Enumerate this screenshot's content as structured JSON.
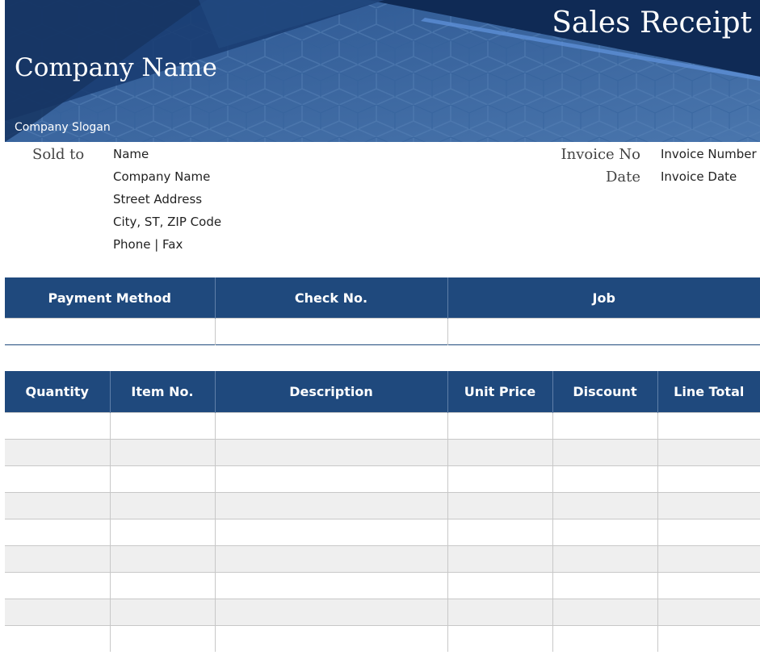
{
  "header": {
    "title": "Sales Receipt",
    "company_name": "Company Name",
    "slogan": "Company Slogan"
  },
  "sold_to": {
    "label": "Sold to",
    "lines": [
      "Name",
      "Company Name",
      "Street Address",
      "City, ST,  ZIP Code",
      "Phone  |  Fax"
    ]
  },
  "invoice": {
    "number_label": "Invoice No",
    "number_value": "Invoice Number",
    "date_label": "Date",
    "date_value": "Invoice Date"
  },
  "payment_table": {
    "headers": [
      "Payment Method",
      "Check No.",
      "Job"
    ]
  },
  "items_table": {
    "headers": [
      "Quantity",
      "Item No.",
      "Description",
      "Unit Price",
      "Discount",
      "Line Total"
    ]
  },
  "colors": {
    "header_blue": "#1f497d",
    "banner_blue": "#3a65a0",
    "row_alt": "#efefef"
  }
}
